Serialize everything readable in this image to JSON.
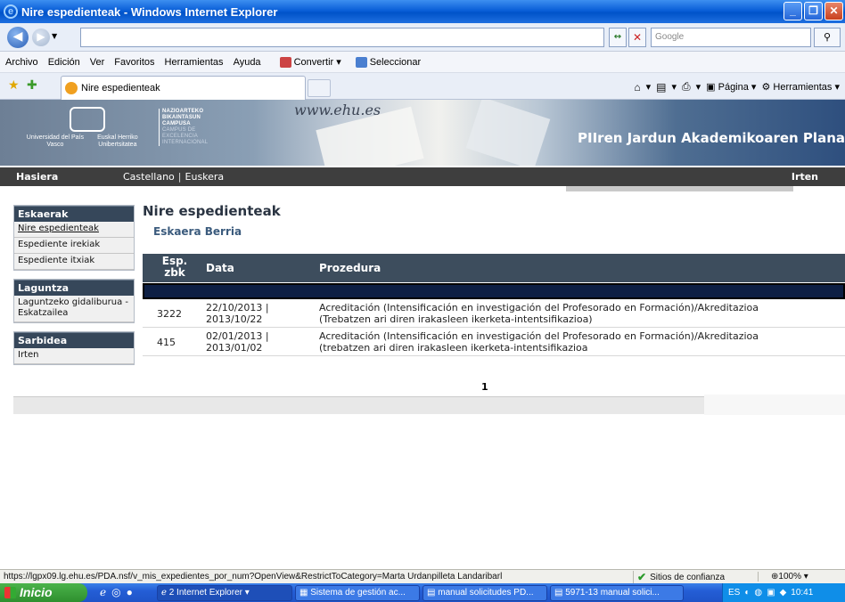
{
  "window": {
    "title": "Nire espedienteak - Windows Internet Explorer"
  },
  "address": {
    "url": "",
    "search_placeholder": "Google"
  },
  "menu": [
    "Archivo",
    "Edición",
    "Ver",
    "Favoritos",
    "Herramientas",
    "Ayuda"
  ],
  "toolbar": {
    "convert_label": "Convertir",
    "select_label": "Seleccionar"
  },
  "tab": {
    "title": "Nire espedienteak"
  },
  "commands": {
    "page_label": "Página",
    "tools_label": "Herramientas"
  },
  "banner": {
    "uni_es": "Universidad del País Vasco",
    "uni_eu": "Euskal Herriko Unibertsitatea",
    "campus_lines": [
      "NAZIOARTEKO",
      "BIKAINTASUN",
      "CAMPUSA",
      "CAMPUS DE",
      "EXCELENCIA",
      "INTERNACIONAL"
    ],
    "www": "www.ehu.es",
    "app_title": "PIIren Jardun Akademikoaren Plana"
  },
  "nav": {
    "home": "Hasiera",
    "lang_es": "Castellano",
    "lang_eu": "Euskera",
    "logout": "Irten"
  },
  "sidebar": {
    "groups": [
      {
        "title": "Eskaerak",
        "items": [
          "Nire espedienteak",
          "Espediente irekiak",
          "Espediente itxiak"
        ]
      },
      {
        "title": "Laguntza",
        "items": [
          "Laguntzeko gidaliburua - Eskatzailea"
        ]
      },
      {
        "title": "Sarbidea",
        "items": [
          "Irten"
        ]
      }
    ]
  },
  "main": {
    "heading": "Nire espedienteak",
    "new_request": "Eskaera Berria",
    "columns": [
      "Esp. zbk",
      "Data",
      "Prozedura"
    ],
    "rows": [
      {
        "num": "3222",
        "date_line1": "22/10/2013 |",
        "date_line2": "2013/10/22",
        "proc_line1": "Acreditación (Intensificación en investigación del Profesorado en Formación)/Akreditazioa",
        "proc_line2": "(Trebatzen ari diren irakasleen ikerketa-intentsifikazioa)"
      },
      {
        "num": "415",
        "date_line1": "02/01/2013 |",
        "date_line2": "2013/01/02",
        "proc_line1": "Acreditación (Intensificación en investigación del Profesorado en Formación)/Akreditazioa",
        "proc_line2": "(trebatzen ari diren irakasleen ikerketa-intentsifikazioa"
      }
    ],
    "page": "1"
  },
  "status": {
    "url": "https://lgpx09.lg.ehu.es/PDA.nsf/v_mis_expedientes_por_num?OpenView&RestrictToCategory=Marta Urdanpilleta Landaribarl",
    "zone": "Sitios de confianza",
    "zoom": "100%"
  },
  "taskbar": {
    "start": "Inicio",
    "tasks": [
      "2 Internet Explorer",
      "Sistema de gestión ac...",
      "manual solicitudes PD...",
      "5971-13 manual solici..."
    ],
    "lang": "ES",
    "clock": "10:41"
  }
}
